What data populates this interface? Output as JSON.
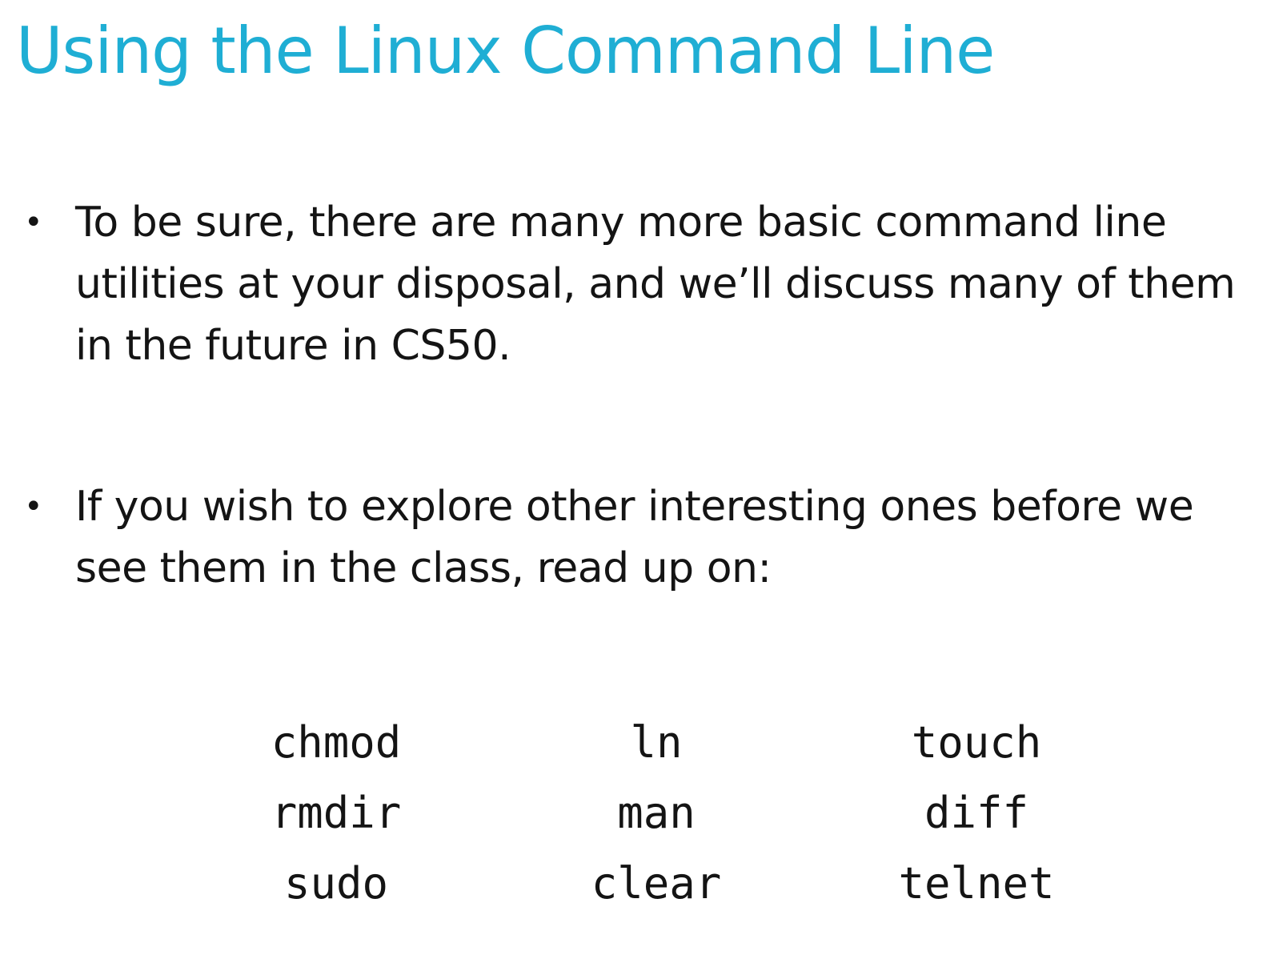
{
  "slide": {
    "title": "Using the Linux Command Line",
    "title_color": "#1faed4",
    "bullets": [
      {
        "marker": "•",
        "text": "To be sure, there are many more basic command line utilities at your disposal, and we’ll discuss many of them in the future in CS50."
      },
      {
        "marker": "•",
        "text": "If you wish to explore other interesting ones before we see them in the class, read up on:"
      }
    ],
    "commands": [
      "chmod",
      "ln",
      "touch",
      "rmdir",
      "man",
      "diff",
      "sudo",
      "clear",
      "telnet"
    ]
  }
}
